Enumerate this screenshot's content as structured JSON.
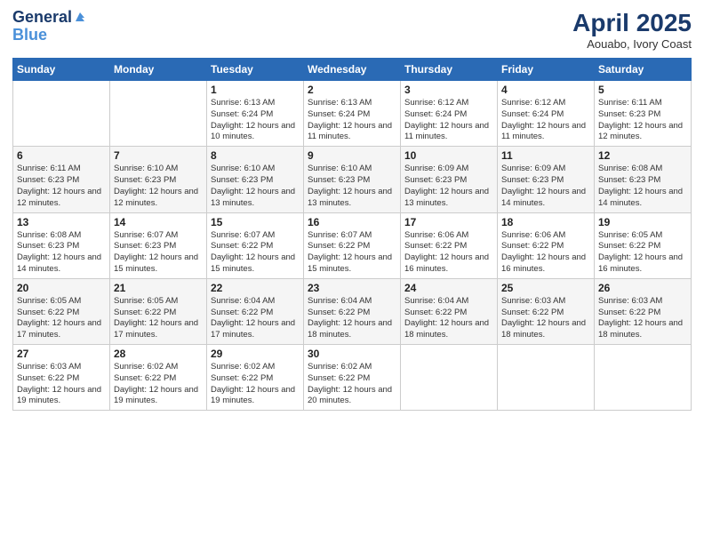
{
  "logo": {
    "line1": "General",
    "line2": "Blue"
  },
  "header": {
    "month": "April 2025",
    "location": "Aouabo, Ivory Coast"
  },
  "weekdays": [
    "Sunday",
    "Monday",
    "Tuesday",
    "Wednesday",
    "Thursday",
    "Friday",
    "Saturday"
  ],
  "weeks": [
    [
      {
        "day": "",
        "info": ""
      },
      {
        "day": "",
        "info": ""
      },
      {
        "day": "1",
        "info": "Sunrise: 6:13 AM\nSunset: 6:24 PM\nDaylight: 12 hours and 10 minutes."
      },
      {
        "day": "2",
        "info": "Sunrise: 6:13 AM\nSunset: 6:24 PM\nDaylight: 12 hours and 11 minutes."
      },
      {
        "day": "3",
        "info": "Sunrise: 6:12 AM\nSunset: 6:24 PM\nDaylight: 12 hours and 11 minutes."
      },
      {
        "day": "4",
        "info": "Sunrise: 6:12 AM\nSunset: 6:24 PM\nDaylight: 12 hours and 11 minutes."
      },
      {
        "day": "5",
        "info": "Sunrise: 6:11 AM\nSunset: 6:23 PM\nDaylight: 12 hours and 12 minutes."
      }
    ],
    [
      {
        "day": "6",
        "info": "Sunrise: 6:11 AM\nSunset: 6:23 PM\nDaylight: 12 hours and 12 minutes."
      },
      {
        "day": "7",
        "info": "Sunrise: 6:10 AM\nSunset: 6:23 PM\nDaylight: 12 hours and 12 minutes."
      },
      {
        "day": "8",
        "info": "Sunrise: 6:10 AM\nSunset: 6:23 PM\nDaylight: 12 hours and 13 minutes."
      },
      {
        "day": "9",
        "info": "Sunrise: 6:10 AM\nSunset: 6:23 PM\nDaylight: 12 hours and 13 minutes."
      },
      {
        "day": "10",
        "info": "Sunrise: 6:09 AM\nSunset: 6:23 PM\nDaylight: 12 hours and 13 minutes."
      },
      {
        "day": "11",
        "info": "Sunrise: 6:09 AM\nSunset: 6:23 PM\nDaylight: 12 hours and 14 minutes."
      },
      {
        "day": "12",
        "info": "Sunrise: 6:08 AM\nSunset: 6:23 PM\nDaylight: 12 hours and 14 minutes."
      }
    ],
    [
      {
        "day": "13",
        "info": "Sunrise: 6:08 AM\nSunset: 6:23 PM\nDaylight: 12 hours and 14 minutes."
      },
      {
        "day": "14",
        "info": "Sunrise: 6:07 AM\nSunset: 6:23 PM\nDaylight: 12 hours and 15 minutes."
      },
      {
        "day": "15",
        "info": "Sunrise: 6:07 AM\nSunset: 6:22 PM\nDaylight: 12 hours and 15 minutes."
      },
      {
        "day": "16",
        "info": "Sunrise: 6:07 AM\nSunset: 6:22 PM\nDaylight: 12 hours and 15 minutes."
      },
      {
        "day": "17",
        "info": "Sunrise: 6:06 AM\nSunset: 6:22 PM\nDaylight: 12 hours and 16 minutes."
      },
      {
        "day": "18",
        "info": "Sunrise: 6:06 AM\nSunset: 6:22 PM\nDaylight: 12 hours and 16 minutes."
      },
      {
        "day": "19",
        "info": "Sunrise: 6:05 AM\nSunset: 6:22 PM\nDaylight: 12 hours and 16 minutes."
      }
    ],
    [
      {
        "day": "20",
        "info": "Sunrise: 6:05 AM\nSunset: 6:22 PM\nDaylight: 12 hours and 17 minutes."
      },
      {
        "day": "21",
        "info": "Sunrise: 6:05 AM\nSunset: 6:22 PM\nDaylight: 12 hours and 17 minutes."
      },
      {
        "day": "22",
        "info": "Sunrise: 6:04 AM\nSunset: 6:22 PM\nDaylight: 12 hours and 17 minutes."
      },
      {
        "day": "23",
        "info": "Sunrise: 6:04 AM\nSunset: 6:22 PM\nDaylight: 12 hours and 18 minutes."
      },
      {
        "day": "24",
        "info": "Sunrise: 6:04 AM\nSunset: 6:22 PM\nDaylight: 12 hours and 18 minutes."
      },
      {
        "day": "25",
        "info": "Sunrise: 6:03 AM\nSunset: 6:22 PM\nDaylight: 12 hours and 18 minutes."
      },
      {
        "day": "26",
        "info": "Sunrise: 6:03 AM\nSunset: 6:22 PM\nDaylight: 12 hours and 18 minutes."
      }
    ],
    [
      {
        "day": "27",
        "info": "Sunrise: 6:03 AM\nSunset: 6:22 PM\nDaylight: 12 hours and 19 minutes."
      },
      {
        "day": "28",
        "info": "Sunrise: 6:02 AM\nSunset: 6:22 PM\nDaylight: 12 hours and 19 minutes."
      },
      {
        "day": "29",
        "info": "Sunrise: 6:02 AM\nSunset: 6:22 PM\nDaylight: 12 hours and 19 minutes."
      },
      {
        "day": "30",
        "info": "Sunrise: 6:02 AM\nSunset: 6:22 PM\nDaylight: 12 hours and 20 minutes."
      },
      {
        "day": "",
        "info": ""
      },
      {
        "day": "",
        "info": ""
      },
      {
        "day": "",
        "info": ""
      }
    ]
  ]
}
